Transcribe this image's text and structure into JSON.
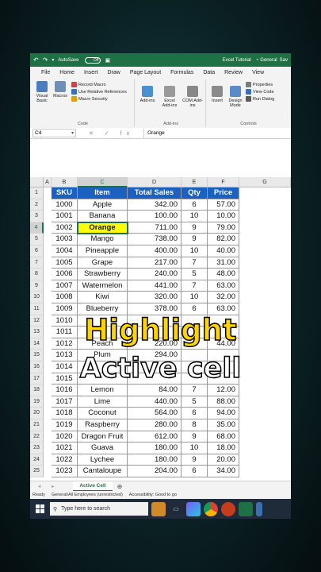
{
  "titlebar": {
    "undo": "↶",
    "redo": "↷",
    "autosave_label": "AutoSave",
    "autosave_state": "Off",
    "file_name": "Excel Tutorial",
    "sensitivity": "General",
    "sensitivity_suffix": "Sav"
  },
  "menu": [
    "File",
    "Home",
    "Insert",
    "Draw",
    "Page Layout",
    "Formulas",
    "Data",
    "Review",
    "View"
  ],
  "ribbon": {
    "code": {
      "visual_basic": "Visual Basic",
      "macros": "Macros",
      "record_macro": "Record Macro",
      "relative_refs": "Use Relative References",
      "macro_security": "Macro Security",
      "label": "Code"
    },
    "addins": {
      "addins": "Add-ins",
      "excel_addins": "Excel Add-ins",
      "com_addins": "COM Add-ins",
      "label": "Add-ins"
    },
    "controls": {
      "insert": "Insert",
      "design_mode": "Design Mode",
      "properties": "Properties",
      "view_code": "View Code",
      "run_dialog": "Run Dialog",
      "label": "Controls"
    }
  },
  "formula_bar": {
    "name_box": "C4",
    "icons": "✕ ✓ fx",
    "value": "Orange"
  },
  "columns": [
    "A",
    "B",
    "C",
    "D",
    "E",
    "F",
    "G"
  ],
  "table": {
    "headers": [
      "SKU",
      "Item",
      "Total Sales",
      "Qty",
      "Price"
    ],
    "rows": [
      [
        "1000",
        "Apple",
        "342.00",
        "6",
        "57.00"
      ],
      [
        "1001",
        "Banana",
        "100.00",
        "10",
        "10.00"
      ],
      [
        "1002",
        "Orange",
        "711.00",
        "9",
        "79.00"
      ],
      [
        "1003",
        "Mango",
        "738.00",
        "9",
        "82.00"
      ],
      [
        "1004",
        "Pineapple",
        "400.00",
        "10",
        "40.00"
      ],
      [
        "1005",
        "Grape",
        "217.00",
        "7",
        "31.00"
      ],
      [
        "1006",
        "Strawberry",
        "240.00",
        "5",
        "48.00"
      ],
      [
        "1007",
        "Watermelon",
        "441.00",
        "7",
        "63.00"
      ],
      [
        "1008",
        "Kiwi",
        "320.00",
        "10",
        "32.00"
      ],
      [
        "1009",
        "Blueberry",
        "378.00",
        "6",
        "63.00"
      ],
      [
        "1010",
        "",
        "",
        "",
        ""
      ],
      [
        "1011",
        "",
        "",
        "",
        ""
      ],
      [
        "1012",
        "Peach",
        "220.00",
        "",
        "44.00"
      ],
      [
        "1013",
        "Plum",
        "294.00",
        "",
        ""
      ],
      [
        "1014",
        "",
        "",
        "",
        ""
      ],
      [
        "1015",
        "",
        "",
        "",
        ""
      ],
      [
        "1016",
        "Lemon",
        "84.00",
        "7",
        "12.00"
      ],
      [
        "1017",
        "Lime",
        "440.00",
        "5",
        "88.00"
      ],
      [
        "1018",
        "Coconut",
        "564.00",
        "6",
        "94.00"
      ],
      [
        "1019",
        "Raspberry",
        "280.00",
        "8",
        "35.00"
      ],
      [
        "1020",
        "Dragon Fruit",
        "612.00",
        "9",
        "68.00"
      ],
      [
        "1021",
        "Guava",
        "180.00",
        "10",
        "18.00"
      ],
      [
        "1022",
        "Lychee",
        "180.00",
        "9",
        "20.00"
      ],
      [
        "1023",
        "Cantaloupe",
        "204.00",
        "6",
        "34.00"
      ]
    ]
  },
  "row_numbers": [
    "1",
    "2",
    "3",
    "4",
    "5",
    "6",
    "7",
    "8",
    "9",
    "10",
    "11",
    "12",
    "13",
    "14",
    "15",
    "16",
    "17",
    "18",
    "19",
    "20",
    "21",
    "22",
    "23",
    "24",
    "25"
  ],
  "overlay": {
    "line1": "Highlight",
    "line2": "Active cell"
  },
  "sheet_tab": "Active Cell",
  "sheet_nav": "◂ ▸",
  "add_sheet": "⊕",
  "status": {
    "ready": "Ready",
    "sensitivity": "General\\All Employees (unrestricted)",
    "accessibility": "Accessibility: Good to go"
  },
  "taskbar": {
    "search_placeholder": "Type here to search"
  },
  "colors": {
    "excel_green": "#1e7145",
    "header_blue": "#1a61c2",
    "highlight_yellow": "#ffff00",
    "overlay_yellow": "#ffd400"
  }
}
